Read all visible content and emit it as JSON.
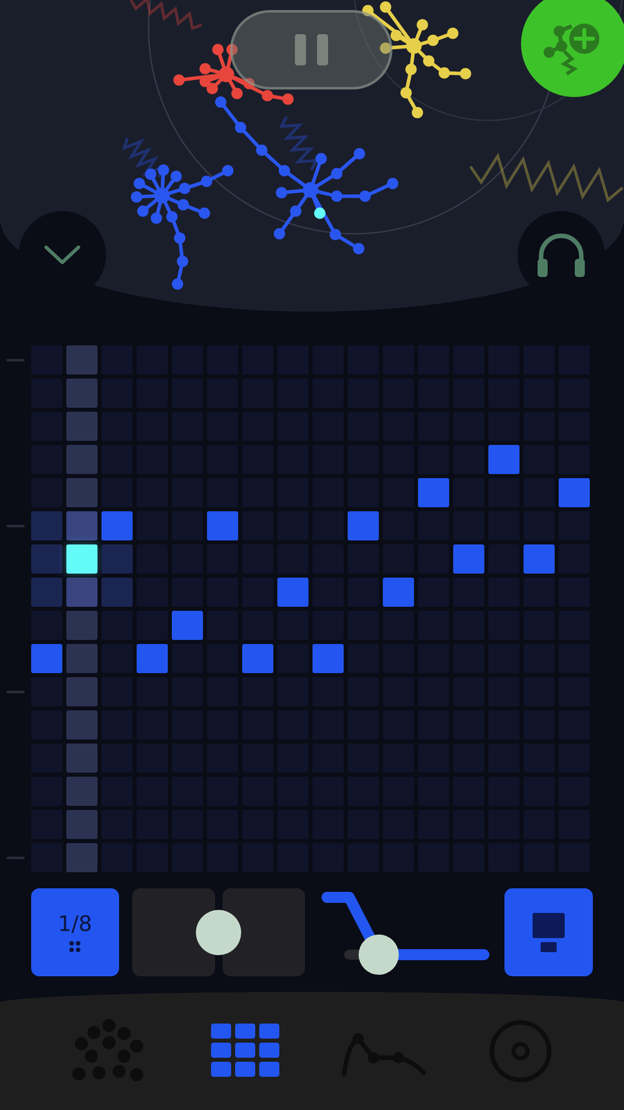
{
  "instruments": [
    {
      "color": "#e8453c",
      "selected": false
    },
    {
      "color": "#e6cf4a",
      "selected": false
    },
    {
      "color": "#2a56f0",
      "selected": true
    },
    {
      "color": "#2a56f0",
      "selected": false
    }
  ],
  "headphones": {
    "on": true
  },
  "grid": {
    "columns": [
      {
        "playhead": false
      },
      {
        "playhead": true
      },
      {
        "playhead": false
      },
      {
        "playhead": false
      },
      {
        "playhead": false
      },
      {
        "playhead": false
      },
      {
        "playhead": false
      },
      {
        "playhead": false
      },
      {
        "playhead": false
      },
      {
        "playhead": false
      },
      {
        "playhead": false
      },
      {
        "playhead": false
      },
      {
        "playhead": false
      },
      {
        "playhead": false
      },
      {
        "playhead": false
      },
      {
        "playhead": false
      }
    ],
    "rows": [
      {
        "on": [
          false,
          false,
          false,
          false,
          false,
          false,
          false,
          false,
          false,
          false,
          false,
          false,
          false,
          false,
          false,
          false
        ],
        "playing": [
          false,
          false,
          false,
          false,
          false,
          false,
          false,
          false,
          false,
          false,
          false,
          false,
          false,
          false,
          false,
          false
        ]
      },
      {
        "on": [
          false,
          false,
          false,
          false,
          false,
          false,
          false,
          false,
          false,
          false,
          false,
          false,
          false,
          false,
          false,
          false
        ],
        "playing": [
          false,
          false,
          false,
          false,
          false,
          false,
          false,
          false,
          false,
          false,
          false,
          false,
          false,
          false,
          false,
          false
        ]
      },
      {
        "on": [
          false,
          false,
          false,
          false,
          false,
          false,
          false,
          false,
          false,
          false,
          false,
          false,
          false,
          false,
          false,
          false
        ],
        "playing": [
          false,
          false,
          false,
          false,
          false,
          false,
          false,
          false,
          false,
          false,
          false,
          false,
          false,
          false,
          false,
          false
        ]
      },
      {
        "on": [
          false,
          false,
          false,
          false,
          false,
          false,
          false,
          false,
          false,
          false,
          false,
          false,
          false,
          true,
          false,
          false
        ],
        "playing": [
          false,
          false,
          false,
          false,
          false,
          false,
          false,
          false,
          false,
          false,
          false,
          false,
          false,
          false,
          false,
          false
        ]
      },
      {
        "on": [
          false,
          false,
          false,
          false,
          false,
          false,
          false,
          false,
          false,
          false,
          false,
          true,
          false,
          false,
          false,
          true
        ],
        "playing": [
          false,
          false,
          false,
          false,
          false,
          false,
          false,
          false,
          false,
          false,
          false,
          false,
          false,
          false,
          false,
          false
        ]
      },
      {
        "on": [
          false,
          false,
          true,
          false,
          false,
          true,
          false,
          false,
          false,
          true,
          false,
          false,
          false,
          false,
          false,
          false
        ],
        "playing": [
          false,
          false,
          false,
          false,
          false,
          false,
          false,
          false,
          false,
          false,
          false,
          false,
          false,
          false,
          false,
          false
        ]
      },
      {
        "on": [
          false,
          false,
          false,
          false,
          false,
          false,
          false,
          false,
          false,
          false,
          false,
          false,
          true,
          false,
          true,
          false
        ],
        "playing": [
          false,
          true,
          false,
          false,
          false,
          false,
          false,
          false,
          false,
          false,
          false,
          false,
          false,
          false,
          false,
          false
        ]
      },
      {
        "on": [
          false,
          false,
          false,
          false,
          false,
          false,
          false,
          true,
          false,
          false,
          true,
          false,
          false,
          false,
          false,
          false
        ],
        "playing": [
          false,
          false,
          false,
          false,
          false,
          false,
          false,
          false,
          false,
          false,
          false,
          false,
          false,
          false,
          false,
          false
        ]
      },
      {
        "on": [
          false,
          false,
          false,
          false,
          true,
          false,
          false,
          false,
          false,
          false,
          false,
          false,
          false,
          false,
          false,
          false
        ],
        "playing": [
          false,
          false,
          false,
          false,
          false,
          false,
          false,
          false,
          false,
          false,
          false,
          false,
          false,
          false,
          false,
          false
        ]
      },
      {
        "on": [
          true,
          false,
          false,
          true,
          false,
          false,
          true,
          false,
          true,
          false,
          false,
          false,
          false,
          false,
          false,
          false
        ],
        "playing": [
          false,
          false,
          false,
          false,
          false,
          false,
          false,
          false,
          false,
          false,
          false,
          false,
          false,
          false,
          false,
          false
        ]
      },
      {
        "on": [
          false,
          false,
          false,
          false,
          false,
          false,
          false,
          false,
          false,
          false,
          false,
          false,
          false,
          false,
          false,
          false
        ],
        "playing": [
          false,
          false,
          false,
          false,
          false,
          false,
          false,
          false,
          false,
          false,
          false,
          false,
          false,
          false,
          false,
          false
        ]
      },
      {
        "on": [
          false,
          false,
          false,
          false,
          false,
          false,
          false,
          false,
          false,
          false,
          false,
          false,
          false,
          false,
          false,
          false
        ],
        "playing": [
          false,
          false,
          false,
          false,
          false,
          false,
          false,
          false,
          false,
          false,
          false,
          false,
          false,
          false,
          false,
          false
        ]
      },
      {
        "on": [
          false,
          false,
          false,
          false,
          false,
          false,
          false,
          false,
          false,
          false,
          false,
          false,
          false,
          false,
          false,
          false
        ],
        "playing": [
          false,
          false,
          false,
          false,
          false,
          false,
          false,
          false,
          false,
          false,
          false,
          false,
          false,
          false,
          false,
          false
        ]
      },
      {
        "on": [
          false,
          false,
          false,
          false,
          false,
          false,
          false,
          false,
          false,
          false,
          false,
          false,
          false,
          false,
          false,
          false
        ],
        "playing": [
          false,
          false,
          false,
          false,
          false,
          false,
          false,
          false,
          false,
          false,
          false,
          false,
          false,
          false,
          false,
          false
        ]
      },
      {
        "on": [
          false,
          false,
          false,
          false,
          false,
          false,
          false,
          false,
          false,
          false,
          false,
          false,
          false,
          false,
          false,
          false
        ],
        "playing": [
          false,
          false,
          false,
          false,
          false,
          false,
          false,
          false,
          false,
          false,
          false,
          false,
          false,
          false,
          false,
          false
        ]
      },
      {
        "on": [
          false,
          false,
          false,
          false,
          false,
          false,
          false,
          false,
          false,
          false,
          false,
          false,
          false,
          false,
          false,
          false
        ],
        "playing": [
          false,
          false,
          false,
          false,
          false,
          false,
          false,
          false,
          false,
          false,
          false,
          false,
          false,
          false,
          false,
          false
        ]
      }
    ]
  },
  "controls": {
    "rate": {
      "label": "1/8"
    },
    "toggle": {
      "level": 0.5
    },
    "envelope": {
      "level": 0.32
    }
  },
  "nav": [
    {
      "selected": false
    },
    {
      "selected": true
    },
    {
      "selected": false
    },
    {
      "selected": false
    }
  ]
}
